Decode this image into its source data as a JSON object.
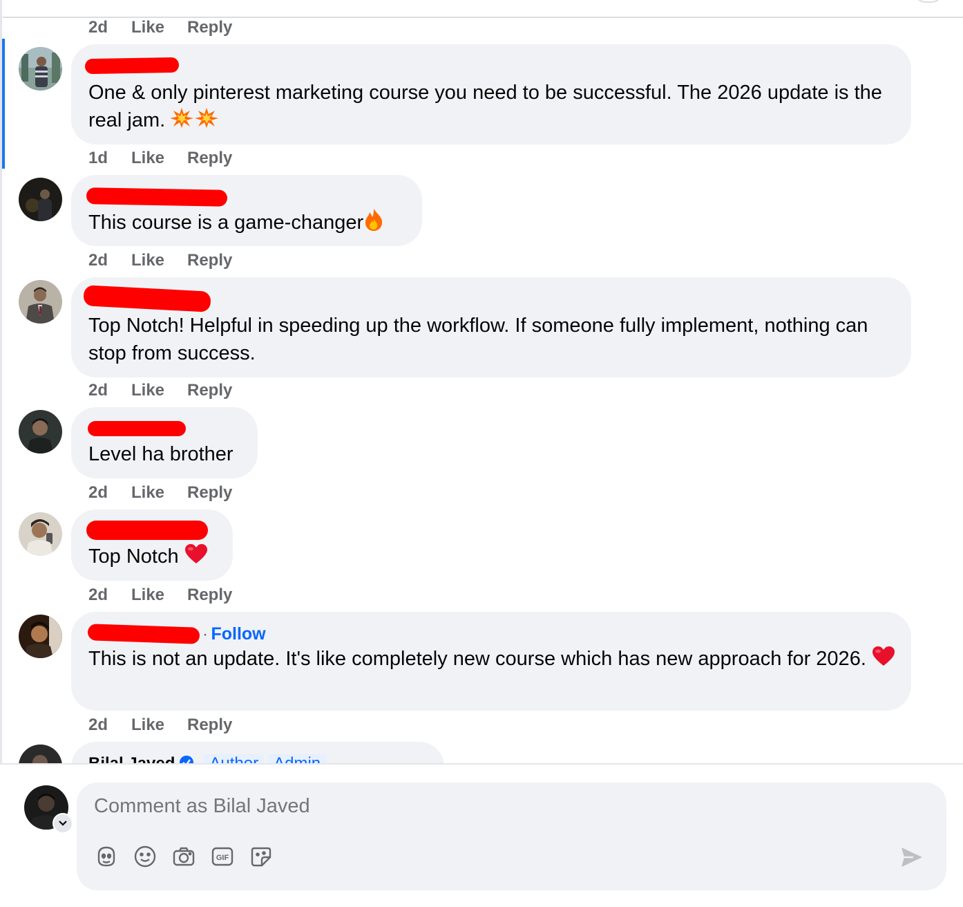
{
  "action_labels": {
    "like": "Like",
    "reply": "Reply"
  },
  "top_meta": {
    "time": "2d"
  },
  "comments": [
    {
      "time": "1d",
      "text": "One & only pinterest marketing course you need to be successful. The 2026 update is the real jam.",
      "emoji": "collision-emoji",
      "highlighted": true
    },
    {
      "time": "2d",
      "text": "This course is a game-changer",
      "emoji": "fire-emoji"
    },
    {
      "time": "2d",
      "text": "Top Notch! Helpful in speeding up the workflow. If someone fully implement, nothing can stop from success."
    },
    {
      "time": "2d",
      "text": "Level ha brother"
    },
    {
      "time": "2d",
      "text": "Top Notch",
      "emoji": "heart-emoji"
    },
    {
      "time": "2d",
      "text": "This is not an update. It's like completely new course which has new approach for 2026.",
      "emoji": "heart-emoji",
      "follow": "Follow",
      "follow_sep": "·"
    }
  ],
  "partial_comment": {
    "name": "Bilal Javed",
    "badges": [
      "Author",
      "Admin"
    ],
    "verified_icon": "verified-badge-icon"
  },
  "composer": {
    "placeholder": "Comment as Bilal Javed",
    "tools": [
      "avatar-sticker-icon",
      "emoji-icon",
      "camera-icon",
      "gif-icon",
      "sticker-icon"
    ],
    "send_icon": "send-icon"
  },
  "colors": {
    "bubble": "#f0f2f5",
    "meta": "#65676b",
    "link": "#0866ff",
    "highlight": "#1877f2",
    "redaction": "#ff0000"
  }
}
